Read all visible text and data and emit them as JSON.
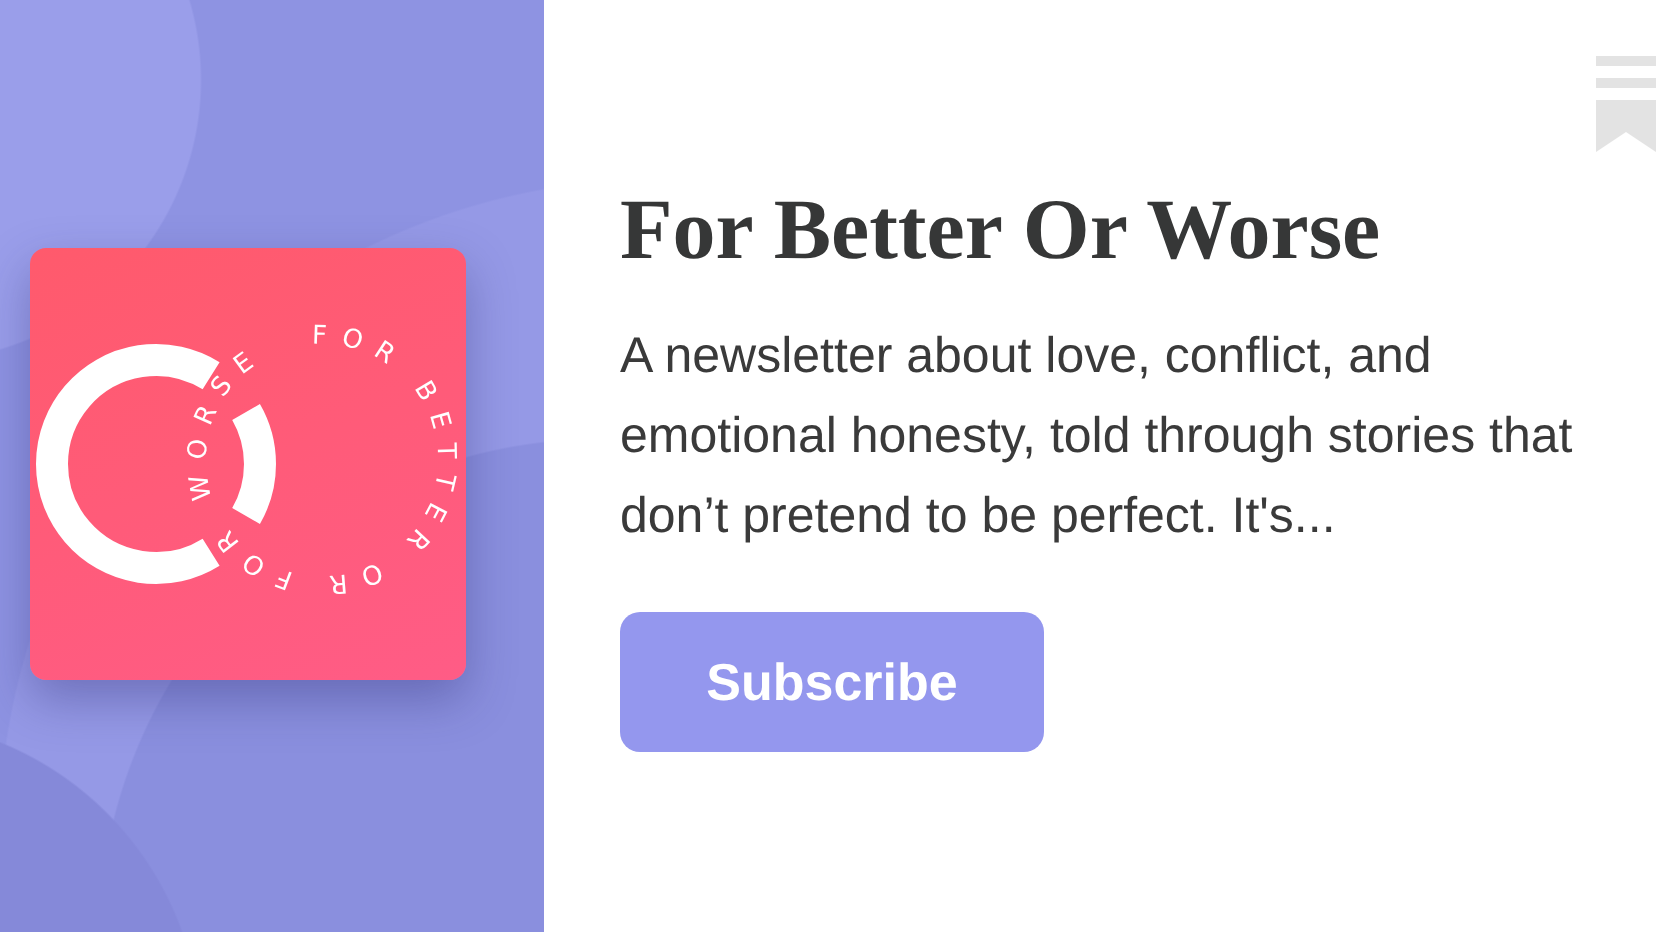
{
  "cover": {
    "logo_text": "FOR BETTER OR FOR WORSE"
  },
  "title": "For Better Or Worse",
  "description": "A newsletter about love, conflict, and emotional honesty, told through stories that don’t pretend to be perfect. It's...",
  "subscribe_button": {
    "label": "Subscribe"
  }
}
